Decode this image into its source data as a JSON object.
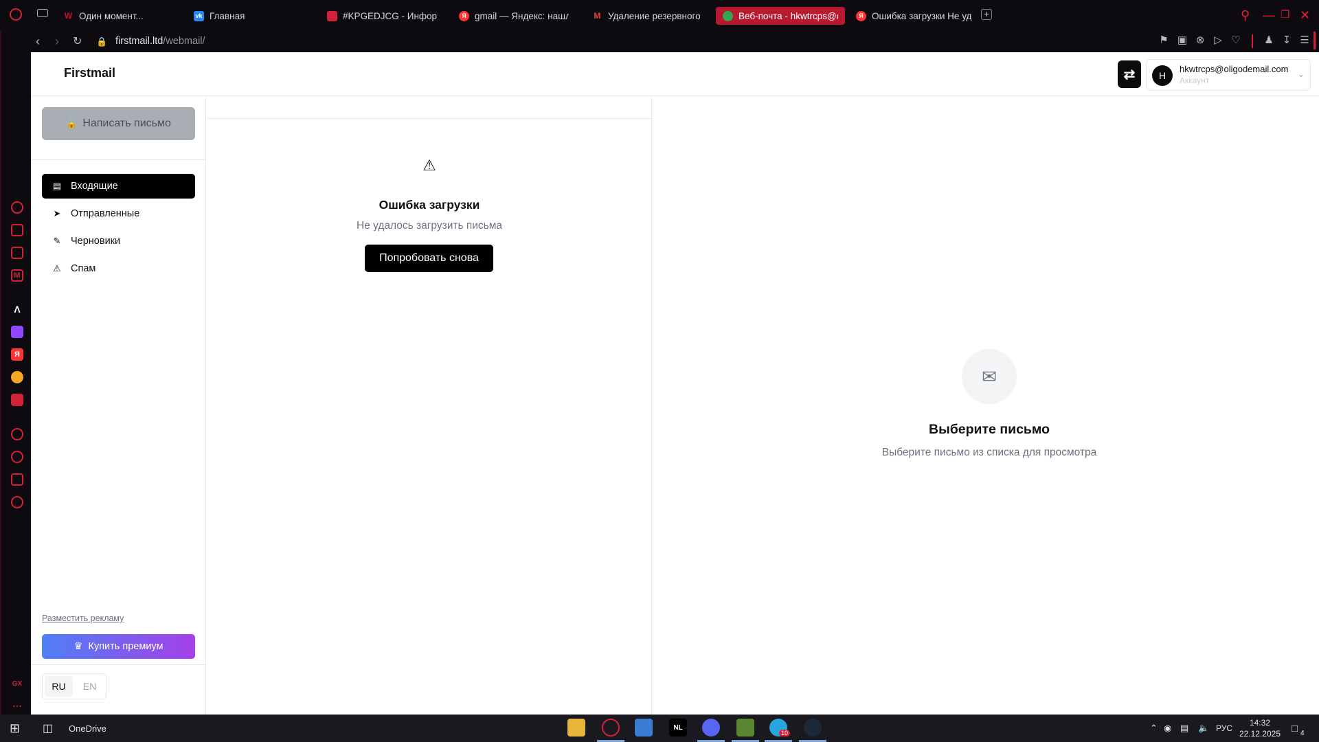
{
  "browser": {
    "tabs": [
      {
        "title": "Один момент...",
        "favicon": "W",
        "color": "#c8102e"
      },
      {
        "title": "Главная",
        "favicon": "vk",
        "color": "#2787f5"
      },
      {
        "title": "#KPGEDJCG - Информа",
        "favicon": "lock",
        "color": "#d4213a"
      },
      {
        "title": "gmail — Яндекс: нашлос",
        "favicon": "Я",
        "color": "#f33"
      },
      {
        "title": "Удаление резервного е",
        "favicon": "M",
        "color": "#ea4335"
      },
      {
        "title": "Веб-почта - hkwtrcps@o",
        "favicon": "leaf",
        "color": "#2fa84f"
      },
      {
        "title": "Ошибка загрузки Не уда",
        "favicon": "Я",
        "color": "#f33"
      }
    ],
    "url_host": "firstmail.ltd",
    "url_path": "/webmail/"
  },
  "app": {
    "brand": "Firstmail",
    "account": {
      "initial": "H",
      "email": "hkwtrcps@oligodemail.com",
      "subtitle": "Аккаунт"
    },
    "compose_label": "Написать письмо",
    "folders": [
      {
        "label": "Входящие",
        "icon": "inbox-icon",
        "active": true
      },
      {
        "label": "Отправленные",
        "icon": "paper-plane-icon",
        "active": false
      },
      {
        "label": "Черновики",
        "icon": "edit-icon",
        "active": false
      },
      {
        "label": "Спам",
        "icon": "warning-icon",
        "active": false
      }
    ],
    "ads_link": "Разместить рекламу",
    "premium_label": "Купить премиум",
    "languages": [
      "RU",
      "EN"
    ],
    "active_language": "RU",
    "list_error": {
      "title": "Ошибка загрузки",
      "subtitle": "Не удалось загрузить письма",
      "retry_label": "Попробовать снова"
    },
    "empty_view": {
      "title": "Выберите письмо",
      "subtitle": "Выберите письмо из списка для просмотра"
    }
  },
  "taskbar": {
    "pinned_label": "OneDrive",
    "language": "РУС",
    "time": "14:32",
    "date": "22.12.2025",
    "notifications": "4",
    "telegram_badge": "10"
  }
}
